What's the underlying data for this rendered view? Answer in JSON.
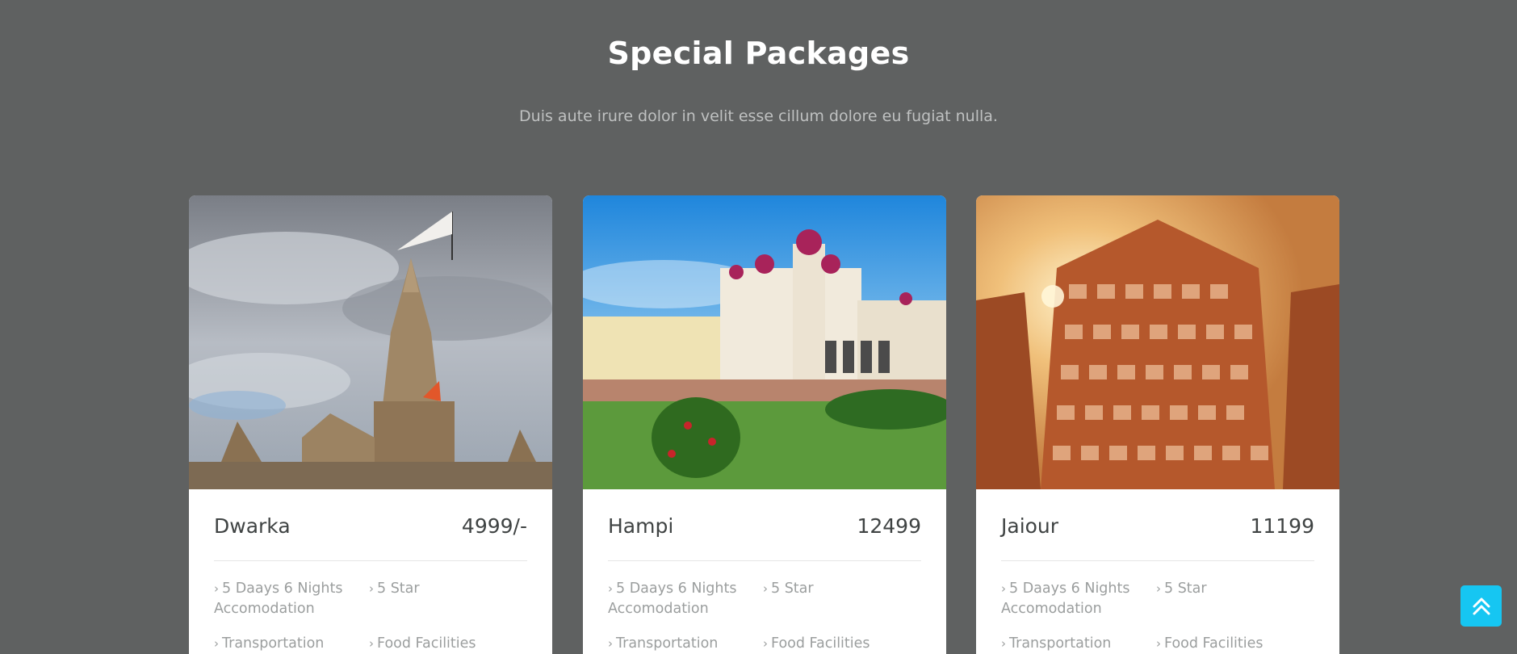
{
  "section": {
    "title": "Special Packages",
    "subtitle": "Duis aute irure dolor in velit esse cillum dolore eu fugiat nulla."
  },
  "packages": [
    {
      "name": "Dwarka",
      "price": "4999/-",
      "features": [
        "5 Daays 6 Nights Accomodation",
        "5 Star",
        "Transportation",
        "Food Facilities"
      ]
    },
    {
      "name": "Hampi",
      "price": "12499",
      "features": [
        "5 Daays 6 Nights Accomodation",
        "5 Star",
        "Transportation",
        "Food Facilities"
      ]
    },
    {
      "name": "Jaiour",
      "price": "11199",
      "features": [
        "5 Daays 6 Nights Accomodation",
        "5 Star",
        "Transportation",
        "Food Facilities"
      ]
    }
  ],
  "icons": {
    "feature_bullet": "chevron-right-icon",
    "scroll_top": "double-chevron-up-icon"
  },
  "colors": {
    "background": "#5f6161",
    "card": "#ffffff",
    "accent": "#16c6f2"
  }
}
